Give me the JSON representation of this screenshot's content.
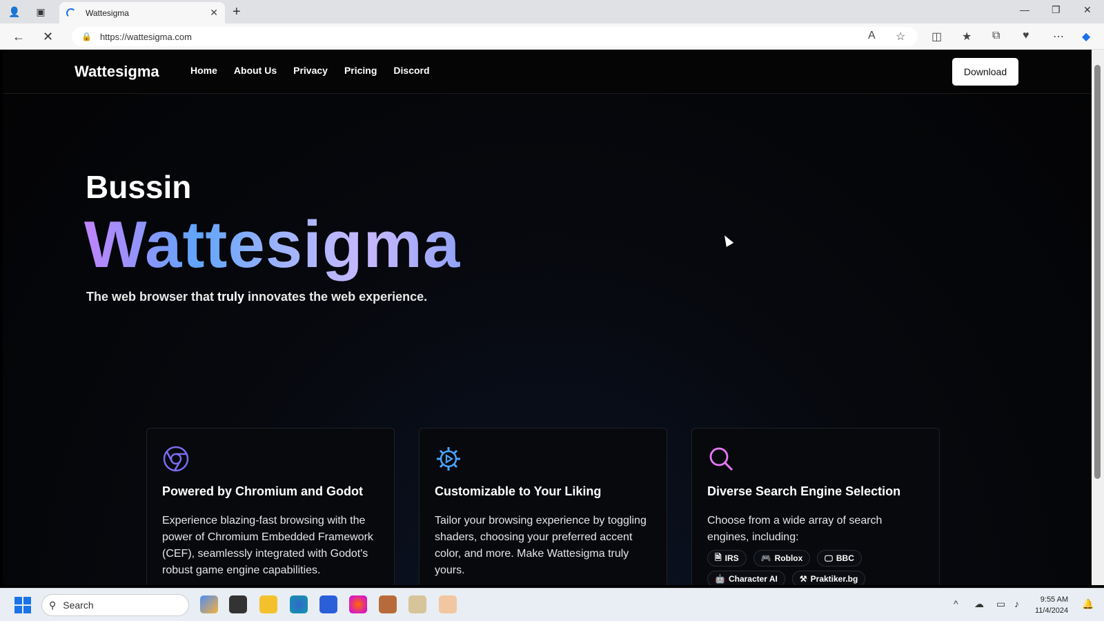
{
  "browser": {
    "tab_title": "Wattesigma",
    "url": "https://wattesigma.com"
  },
  "site": {
    "brand": "Wattesigma",
    "nav": [
      "Home",
      "About Us",
      "Privacy",
      "Pricing",
      "Discord"
    ],
    "download_label": "Download"
  },
  "hero": {
    "pre": "Bussin",
    "title": "Wattesigma",
    "sub_before": "The web browser that ",
    "sub_bold": "truly",
    "sub_after": " innovates the web experience."
  },
  "features": [
    {
      "icon": "chromium-icon",
      "title": "Powered by Chromium and Godot",
      "desc": "Experience blazing-fast browsing with the power of Chromium Embedded Framework (CEF), seamlessly integrated with Godot's robust game engine capabilities.",
      "accent": "#7c6cf0"
    },
    {
      "icon": "gear-icon",
      "title": "Customizable to Your Liking",
      "desc": "Tailor your browsing experience by toggling shaders, choosing your preferred accent color, and more. Make Wattesigma truly yours.",
      "accent": "#4aa3ff"
    },
    {
      "icon": "search-icon",
      "title": "Diverse Search Engine Selection",
      "desc": "Choose from a wide array of search engines, including:",
      "accent": "#e879f9",
      "engines": [
        {
          "label": "IRS",
          "icon": "document-icon"
        },
        {
          "label": "Roblox",
          "icon": "gamepad-icon"
        },
        {
          "label": "BBC",
          "icon": "monitor-icon"
        },
        {
          "label": "Character AI",
          "icon": "robot-icon"
        },
        {
          "label": "Praktiker.bg",
          "icon": "hammer-icon"
        }
      ]
    }
  ],
  "taskbar": {
    "search_placeholder": "Search",
    "time": "9:55 AM",
    "date": "11/4/2024"
  }
}
